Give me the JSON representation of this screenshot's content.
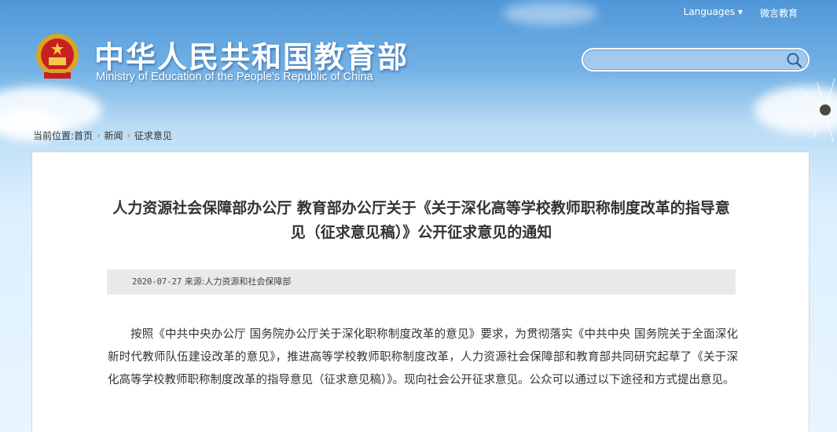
{
  "header": {
    "languages_label": "Languages",
    "weixin_label": "微言教育",
    "title_cn": "中华人民共和国教育部",
    "title_en": "Ministry of Education of the People's Republic of China",
    "search_placeholder": ""
  },
  "breadcrumb": {
    "prefix": "当前位置:",
    "items": [
      "首页",
      "新闻",
      "征求意见"
    ]
  },
  "article": {
    "title": "人力资源社会保障部办公厅 教育部办公厅关于《关于深化高等学校教师职称制度改革的指导意见（征求意见稿）》公开征求意见的通知",
    "date": "2020-07-27",
    "source_label": "来源:",
    "source": "人力资源和社会保障部",
    "body": "按照《中共中央办公厅 国务院办公厅关于深化职称制度改革的意见》要求，为贯彻落实《中共中央 国务院关于全面深化新时代教师队伍建设改革的意见》，推进高等学校教师职称制度改革，人力资源社会保障部和教育部共同研究起草了《关于深化高等学校教师职称制度改革的指导意见（征求意见稿）》。现向社会公开征求意见。公众可以通过以下途径和方式提出意见。"
  },
  "colors": {
    "sky_top": "#4f97d8",
    "sky_bottom": "#e9f5ff",
    "meta_bar": "#e9e9e9",
    "text": "#333333"
  }
}
